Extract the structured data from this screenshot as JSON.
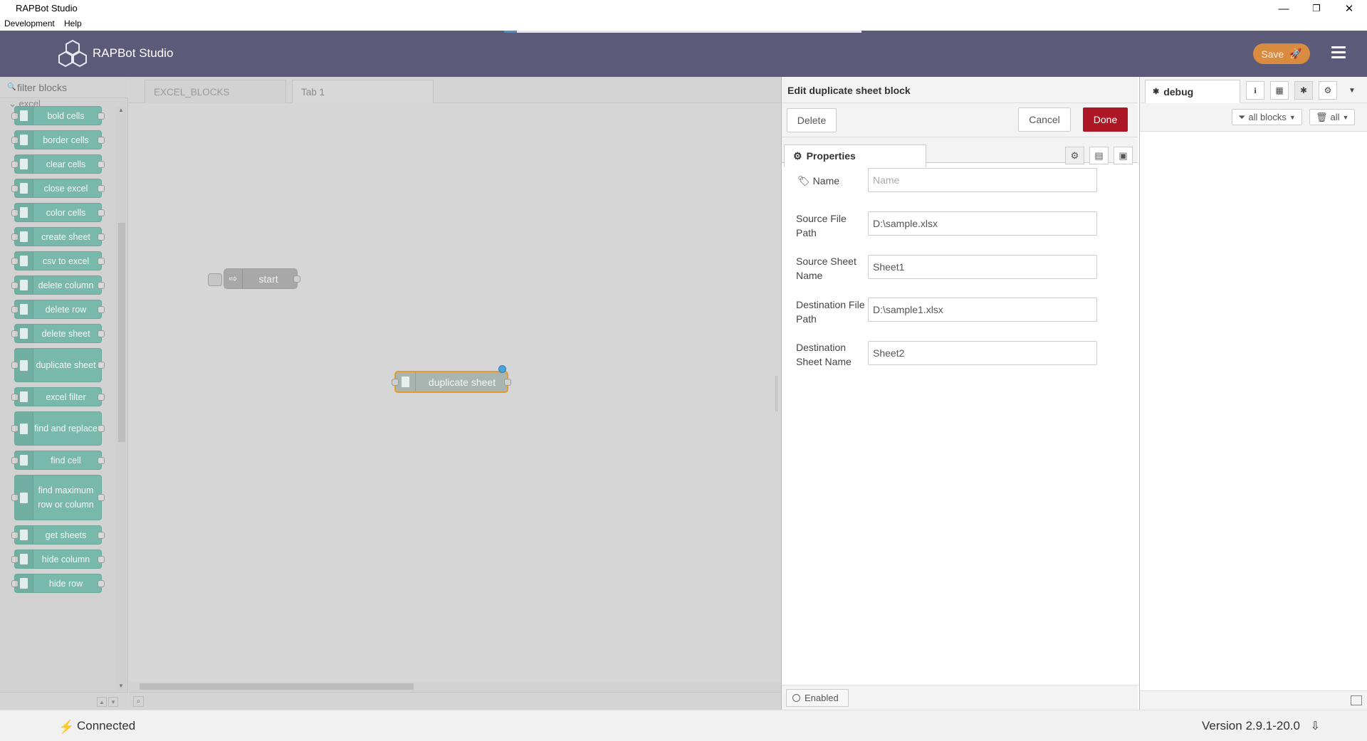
{
  "window": {
    "title": "RAPBot Studio",
    "controls": {
      "minimize": "—",
      "restore": "❐",
      "close": "✕"
    }
  },
  "menu": {
    "items": [
      "Development",
      "Help"
    ]
  },
  "header": {
    "app_name": "RAPBot Studio",
    "save_label": "Save"
  },
  "palette": {
    "filter_placeholder": "filter blocks",
    "category": "excel",
    "nodes": [
      "bold cells",
      "border cells",
      "clear cells",
      "close excel",
      "color cells",
      "create sheet",
      "csv to excel",
      "delete column",
      "delete row",
      "delete sheet",
      "duplicate sheet",
      "excel filter",
      "find and replace",
      "find cell",
      "find maximum row or column",
      "get sheets",
      "hide column",
      "hide row"
    ]
  },
  "workspace": {
    "tabs": [
      "EXCEL_BLOCKS",
      "Tab 1"
    ],
    "active_tab": "Tab 1",
    "nodes": {
      "start": "start",
      "duplicate": "duplicate sheet"
    }
  },
  "editor": {
    "title": "Edit duplicate sheet block",
    "delete_label": "Delete",
    "cancel_label": "Cancel",
    "done_label": "Done",
    "properties_tab": "Properties",
    "fields": {
      "name": {
        "label": "Name",
        "placeholder": "Name",
        "value": ""
      },
      "source_path": {
        "label": "Source File Path",
        "value": "D:\\sample.xlsx"
      },
      "source_sheet": {
        "label": "Source Sheet Name",
        "value": "Sheet1"
      },
      "dest_path": {
        "label": "Destination File Path",
        "value": "D:\\sample1.xlsx"
      },
      "dest_sheet": {
        "label": "Destination Sheet Name",
        "value": "Sheet2"
      }
    },
    "enabled_label": "Enabled"
  },
  "sidebar": {
    "tab_label": "debug",
    "filter_all_blocks": "all blocks",
    "clear_all": "all"
  },
  "status": {
    "connection": "Connected",
    "version": "Version 2.9.1-20.0"
  },
  "colors": {
    "header_bg": "#5b5b79",
    "save_button": "#d98c3f",
    "done_button": "#ad1625",
    "node_excel": "#78b9ab",
    "selected_outline": "#e59a32"
  }
}
